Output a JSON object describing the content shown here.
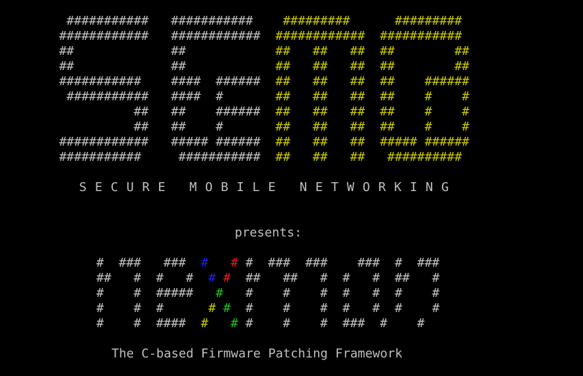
{
  "terminal": {
    "background": "#000000",
    "colors": {
      "grey": "#c0c0c0",
      "yellow": "#c8c800",
      "blue": "#2020e0",
      "red": "#e02020",
      "green": "#20c020"
    },
    "logo_lines": [
      [
        [
          "g",
          "  ###########  "
        ],
        [
          "g",
          " ###########  "
        ],
        [
          "y",
          "  #########    "
        ],
        [
          "y",
          "  #########  "
        ]
      ],
      [
        [
          "g",
          " ############  "
        ],
        [
          "g",
          " ############ "
        ],
        [
          "y",
          " ############ "
        ],
        [
          "y",
          " ###########"
        ]
      ],
      [
        [
          "g",
          " ##            "
        ],
        [
          "g",
          " ##           "
        ],
        [
          "y",
          " ##   ##   ## "
        ],
        [
          "y",
          " ##        ##"
        ]
      ],
      [
        [
          "g",
          " ##            "
        ],
        [
          "g",
          " ##           "
        ],
        [
          "y",
          " ##   ##   ## "
        ],
        [
          "y",
          " ##        ##"
        ]
      ],
      [
        [
          "g",
          " ###########   "
        ],
        [
          "g",
          " ####  ###### "
        ],
        [
          "y",
          " ##   ##   ## "
        ],
        [
          "y",
          " ##    ######"
        ]
      ],
      [
        [
          "g",
          "  ###########  "
        ],
        [
          "g",
          " ####  #      "
        ],
        [
          "y",
          " ##   ##   ## "
        ],
        [
          "y",
          " ##    #    #"
        ]
      ],
      [
        [
          "g",
          "           ##  "
        ],
        [
          "g",
          " ##    ###### "
        ],
        [
          "y",
          " ##   ##   ## "
        ],
        [
          "y",
          " ##    #    #"
        ]
      ],
      [
        [
          "g",
          "           ##  "
        ],
        [
          "g",
          " ##    #      "
        ],
        [
          "y",
          " ##   ##   ## "
        ],
        [
          "y",
          " ##    #    #"
        ]
      ],
      [
        [
          "g",
          " ############  "
        ],
        [
          "g",
          " ##### ###### "
        ],
        [
          "y",
          " ##   ##   ## "
        ],
        [
          "y",
          " ##### ######"
        ]
      ],
      [
        [
          "g",
          " ###########   "
        ],
        [
          "g",
          "  ########### "
        ],
        [
          "y",
          " ##   ##   ## "
        ],
        [
          "y",
          "  ##########"
        ]
      ]
    ],
    "tagline": "S E C U R E   M O B I L E   N E T W O R K I N G",
    "presents": "presents:",
    "nexmon_lines": [
      [
        [
          "g",
          "#  ###   ###  "
        ],
        [
          "b",
          "#"
        ],
        [
          "g",
          "   "
        ],
        [
          "r",
          "#"
        ],
        [
          "g",
          " #  ###  ###    ###  #  ###"
        ]
      ],
      [
        [
          "g",
          "##   #  #   #  "
        ],
        [
          "b",
          "#"
        ],
        [
          "g",
          " "
        ],
        [
          "r",
          "#"
        ],
        [
          "g",
          "  ##   ##   #  #   #  ##   #"
        ]
      ],
      [
        [
          "g",
          "#    #  #####   "
        ],
        [
          "gr",
          "#"
        ],
        [
          "g",
          "   #    #    #  #   #  #    #"
        ]
      ],
      [
        [
          "g",
          "#    #  #      "
        ],
        [
          "y",
          "#"
        ],
        [
          "g",
          " "
        ],
        [
          "gr",
          "#"
        ],
        [
          "g",
          "  #    #    #  #   #  #    #"
        ]
      ],
      [
        [
          "g",
          "#    #  ####  "
        ],
        [
          "y",
          "#"
        ],
        [
          "g",
          "   "
        ],
        [
          "gr",
          "#"
        ],
        [
          "g",
          " #    #    #  ###  #    #"
        ]
      ]
    ],
    "subtitle": "The C-based Firmware Patching Framework"
  }
}
